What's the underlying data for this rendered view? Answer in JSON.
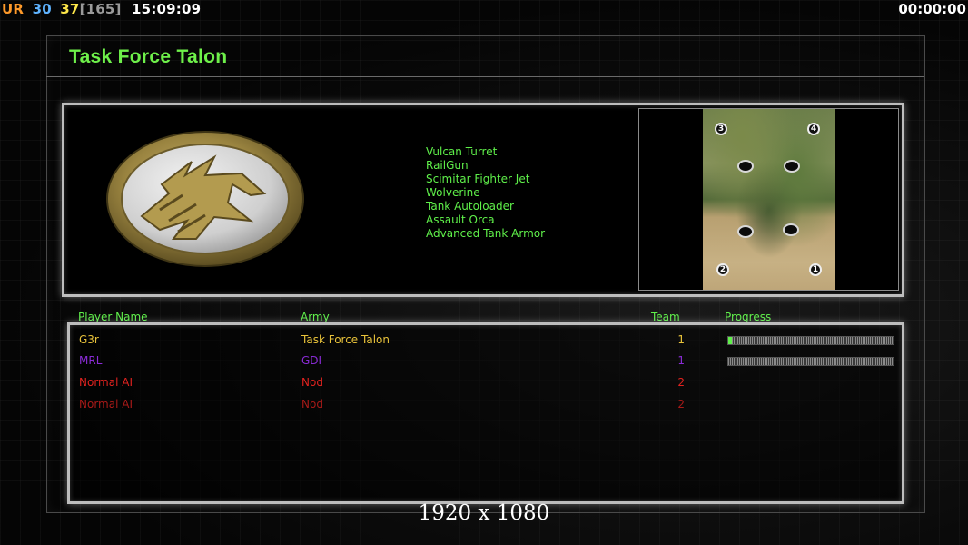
{
  "hud": {
    "ur_label": "UR",
    "value_a": "30",
    "value_b": "37",
    "bracket_value": "[165]",
    "clock": "15:09:09",
    "timer": "00:00:00"
  },
  "briefing": {
    "title": "Task Force Talon",
    "upgrades": [
      "Vulcan Turret",
      "RailGun",
      "Scimitar Fighter Jet",
      "Wolverine",
      "Tank Autoloader",
      "Assault Orca",
      "Advanced Tank Armor"
    ],
    "logo_icon": "gdi-eagle-emblem-icon",
    "minimap": {
      "spawns": [
        "3",
        "4",
        "2",
        "1"
      ]
    }
  },
  "players_table": {
    "headers": {
      "name": "Player Name",
      "army": "Army",
      "team": "Team",
      "progress": "Progress"
    },
    "rows": [
      {
        "name": "G3r",
        "army": "Task Force Talon",
        "team": "1",
        "color": "#e8c23a",
        "progress": 0.02,
        "show_progress": true
      },
      {
        "name": "MRL",
        "army": "GDI",
        "team": "1",
        "color": "#8a2bd6",
        "progress": 0.0,
        "show_progress": true
      },
      {
        "name": "Normal AI",
        "army": "Nod",
        "team": "2",
        "color": "#e0221f",
        "progress": null,
        "show_progress": false
      },
      {
        "name": "Normal AI",
        "army": "Nod",
        "team": "2",
        "color": "#a81a18",
        "progress": null,
        "show_progress": false
      }
    ]
  },
  "resolution_label": "1920 x 1080",
  "colors": {
    "accent_green": "#5ff04a",
    "panel_border": "#bdbdbd"
  }
}
